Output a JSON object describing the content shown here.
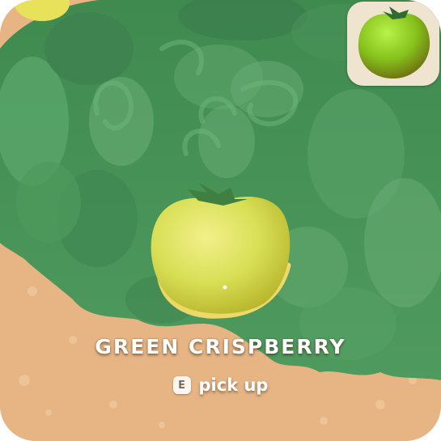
{
  "interaction": {
    "item_name": "GREEN CRISPBERRY",
    "key": "E",
    "action": "pick up"
  },
  "hud": {
    "held_item_icon": "green-crispberry-icon"
  },
  "colors": {
    "ground": "#e7b584",
    "bush": "#4f9a5e",
    "bush_dark": "#3c7f4b",
    "berry": "#d9e35a",
    "glow": "#ffdf6a",
    "slot_bg": "#efe4cf"
  }
}
